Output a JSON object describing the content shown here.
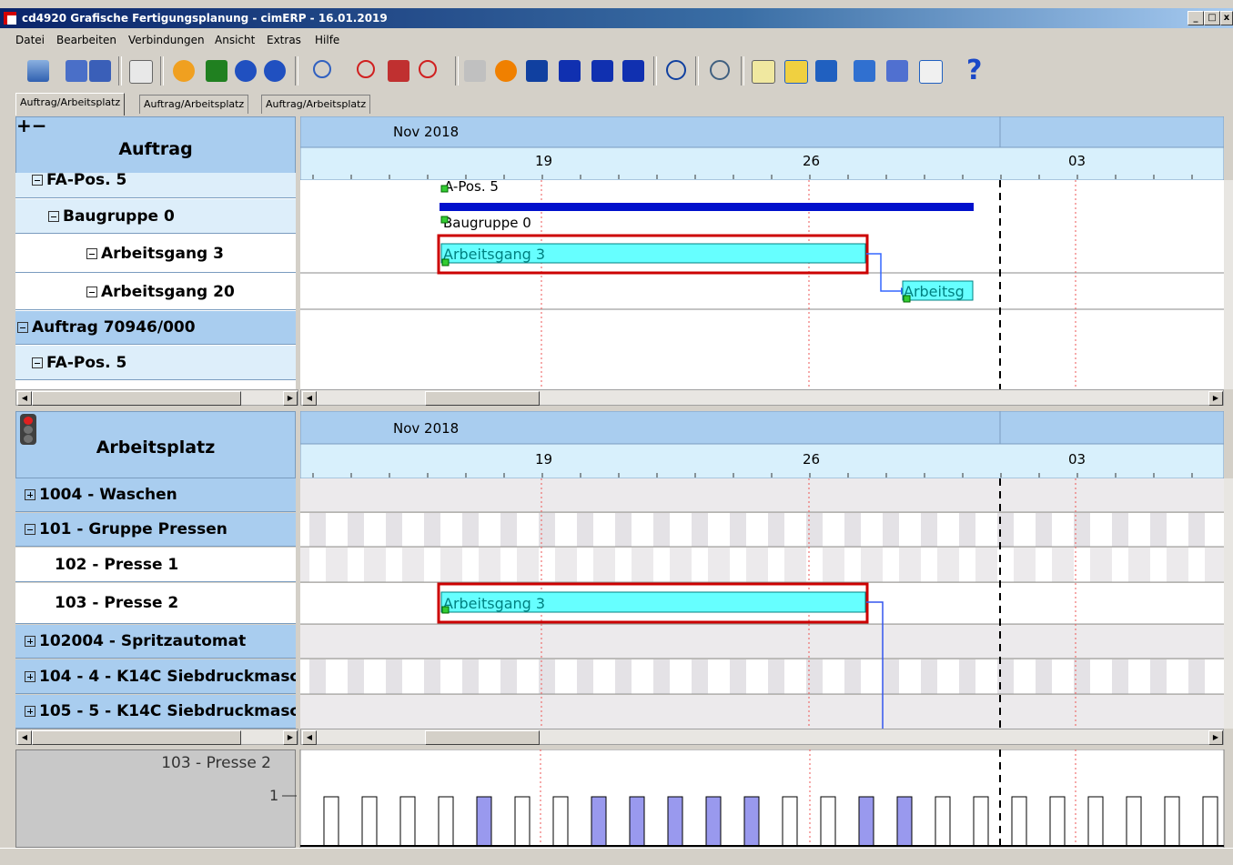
{
  "window": {
    "title": "cd4920 Grafische Fertigungsplanung - cimERP - 16.01.2019"
  },
  "menu": [
    "Datei",
    "Bearbeiten",
    "Verbindungen",
    "Ansicht",
    "Extras",
    "Hilfe"
  ],
  "toolbar": {
    "icons": [
      "exit-icon",
      "save-as-icon",
      "save-icon",
      "refresh-icon",
      "transfer-icon",
      "list-icon",
      "undo-icon",
      "redo-icon",
      "search-icon",
      "zoom-out-icon",
      "car-icon",
      "zoom-in-icon",
      "wand-icon",
      "record-icon",
      "anchor-icon",
      "goto-start-icon",
      "goto-prev-icon",
      "goto-first-icon",
      "stopwatch-icon",
      "mail-icon",
      "note-icon",
      "table-icon",
      "table-export-icon",
      "windows-icon",
      "tag-icon",
      "calculator-icon",
      "help-icon"
    ]
  },
  "tabs": [
    "Auftrag/Arbeitsplatz",
    "Auftrag/Arbeitsplatz",
    "Auftrag/Arbeitsplatz"
  ],
  "top_panel": {
    "header": "Auftrag",
    "month": "Nov 2018",
    "days": [
      "19",
      "26",
      "03"
    ],
    "rows": [
      {
        "label": "FA-Pos. 5",
        "expand": "minus"
      },
      {
        "label": "Baugruppe 0",
        "expand": "minus"
      },
      {
        "label": "Arbeitsgang 3",
        "expand": "minus"
      },
      {
        "label": "Arbeitsgang 20",
        "expand": "minus"
      },
      {
        "label": "Auftrag 70946/000",
        "expand": "minus"
      },
      {
        "label": "FA-Pos. 5",
        "expand": "minus"
      }
    ],
    "bars": {
      "pos": "A-Pos. 5",
      "baugruppe": "Baugruppe 0",
      "ag3": "Arbeitsgang 3",
      "ag20": "Arbeitsg"
    }
  },
  "bottom_panel": {
    "header": "Arbeitsplatz",
    "month": "Nov 2018",
    "days": [
      "19",
      "26",
      "03"
    ],
    "rows": [
      {
        "label": "1004 - Waschen",
        "expand": "plus"
      },
      {
        "label": "101 - Gruppe Pressen",
        "expand": "minus"
      },
      {
        "label": "102 - Presse 1",
        "expand": ""
      },
      {
        "label": "103 - Presse 2",
        "expand": ""
      },
      {
        "label": "102004 - Spritzautomat",
        "expand": "plus"
      },
      {
        "label": "104 - 4 - K14C Siebdruckmasc",
        "expand": "plus"
      },
      {
        "label": "105 - 5 - K14C Siebdruckmasc",
        "expand": "plus"
      }
    ],
    "bar": "Arbeitsgang 3"
  },
  "load_panel": {
    "label": "103 - Presse 2",
    "ytick": "1"
  },
  "colors": {
    "header_blue": "#a9cdef",
    "bar_cyan": "#66ffff",
    "bar_selected": "#cc0000",
    "load_fill": "#9999ee",
    "baugruppe": "#0000cc"
  }
}
